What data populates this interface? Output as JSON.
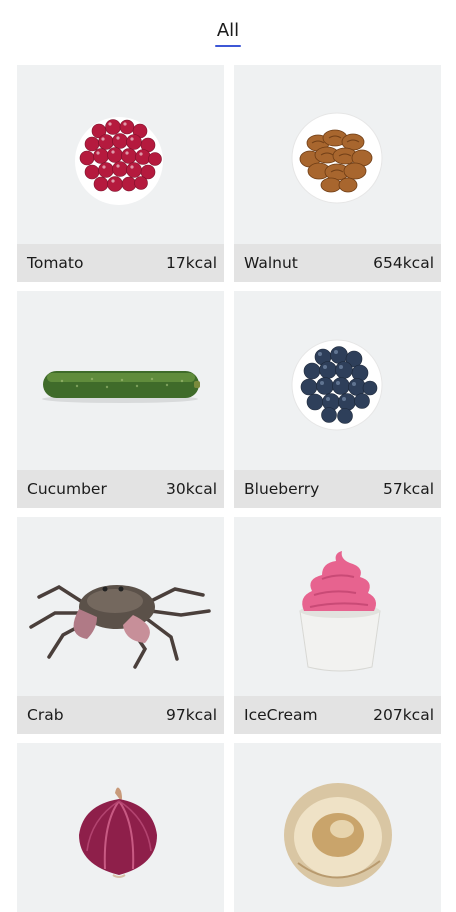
{
  "tabs": {
    "active_label": "All",
    "underline_color": "#3d57d6"
  },
  "cards": [
    {
      "name": "Tomato",
      "kcal": "17kcal",
      "image_icon": "tomato-image"
    },
    {
      "name": "Walnut",
      "kcal": "654kcal",
      "image_icon": "walnut-image"
    },
    {
      "name": "Cucumber",
      "kcal": "30kcal",
      "image_icon": "cucumber-image"
    },
    {
      "name": "Blueberry",
      "kcal": "57kcal",
      "image_icon": "blueberry-image"
    },
    {
      "name": "Crab",
      "kcal": "97kcal",
      "image_icon": "crab-image"
    },
    {
      "name": "IceCream",
      "kcal": "207kcal",
      "image_icon": "icecream-image"
    },
    {
      "name": "",
      "kcal": "",
      "image_icon": "onion-image"
    },
    {
      "name": "",
      "kcal": "",
      "image_icon": "mushroom-image"
    }
  ],
  "colors": {
    "card_background": "#eff1f2",
    "card_footer": "#e3e3e3",
    "text": "#1b1b1b"
  }
}
